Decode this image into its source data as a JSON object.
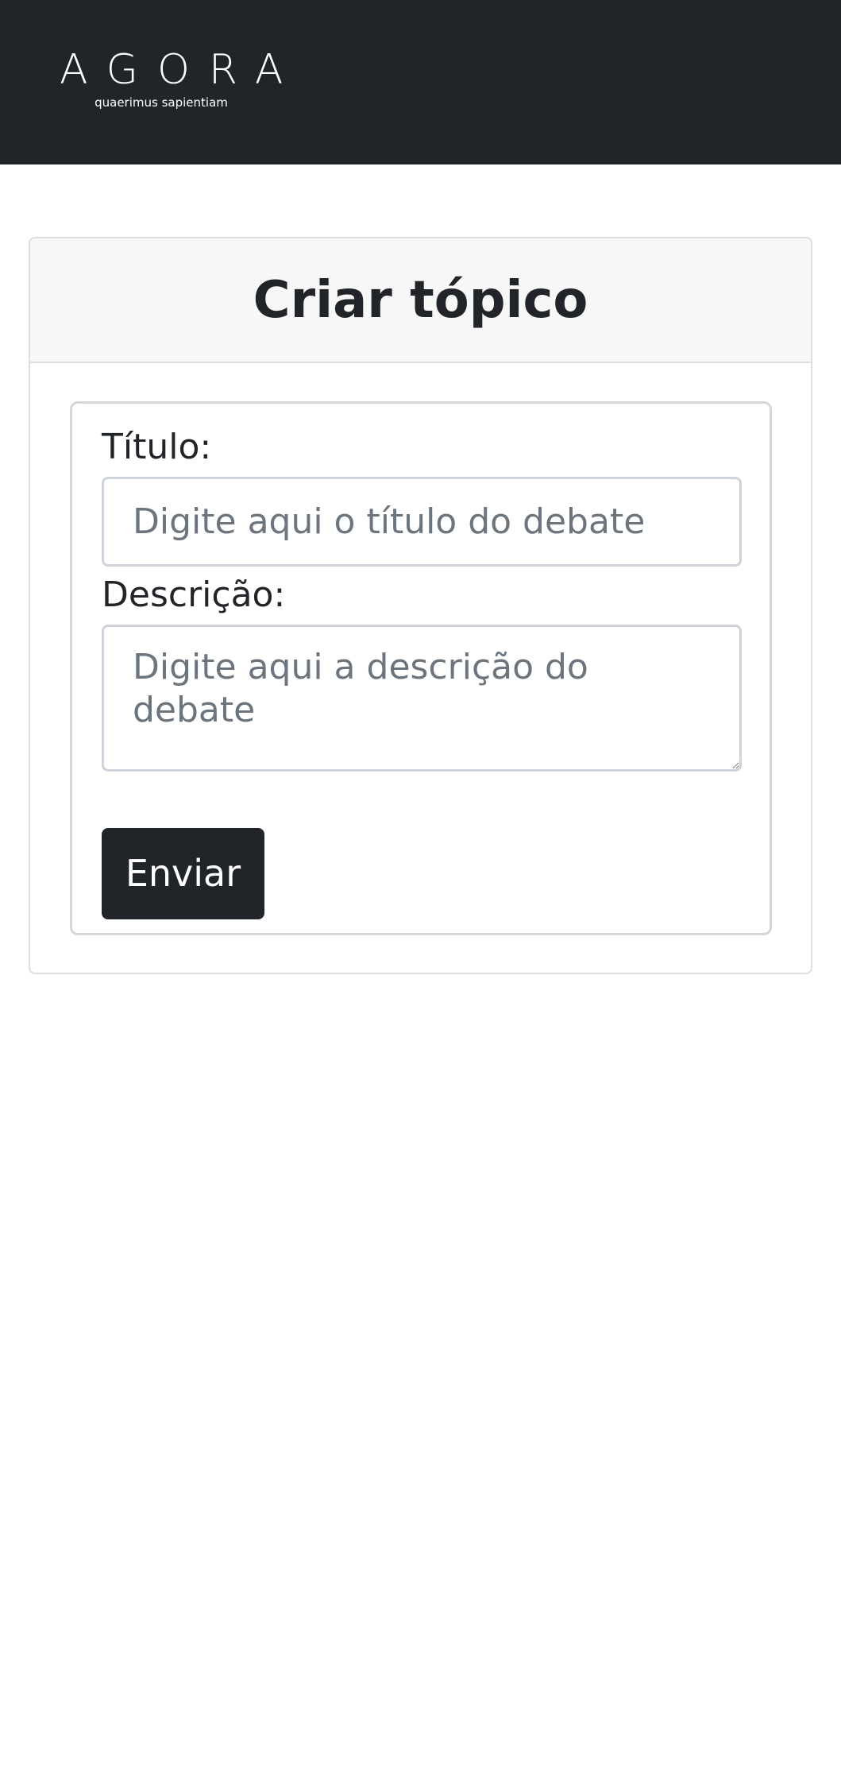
{
  "navbar": {
    "brand_name": "AGORA",
    "brand_motto": "quaerimus sapientiam",
    "background_color": "#212529"
  },
  "card": {
    "title": "Criar tópico"
  },
  "form": {
    "title_label": "Título:",
    "title_placeholder": "Digite aqui o título do debate",
    "title_value": "",
    "description_label": "Descrição:",
    "description_placeholder": "Digite aqui a descrição do debate",
    "description_value": "",
    "submit_label": "Enviar",
    "submit_color": "#212529"
  }
}
